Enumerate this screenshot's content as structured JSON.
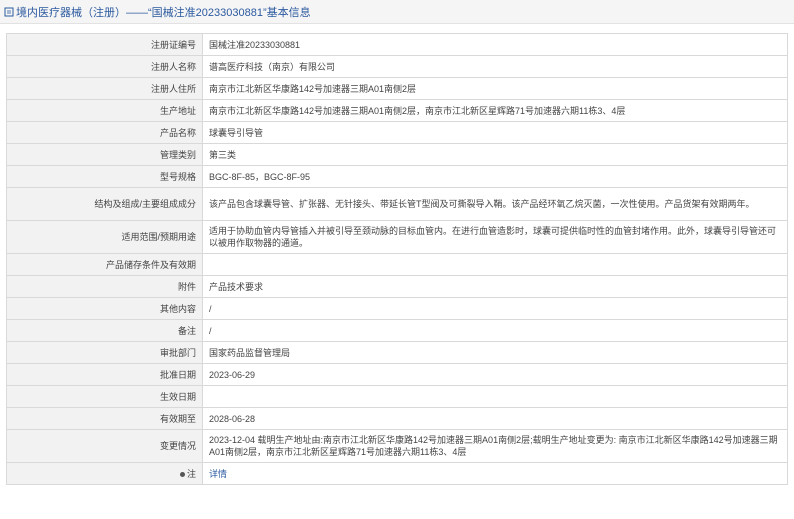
{
  "header": {
    "title": "境内医疗器械（注册）——“国械注准20233030881”基本信息"
  },
  "rows": [
    {
      "label": "注册证编号",
      "value": "国械注准20233030881"
    },
    {
      "label": "注册人名称",
      "value": "谱高医疗科技（南京）有限公司"
    },
    {
      "label": "注册人住所",
      "value": "南京市江北新区华康路142号加速器三期A01南侧2层"
    },
    {
      "label": "生产地址",
      "value": "南京市江北新区华康路142号加速器三期A01南侧2层，南京市江北新区星辉路71号加速器六期11栋3、4层"
    },
    {
      "label": "产品名称",
      "value": "球囊导引导管"
    },
    {
      "label": "管理类别",
      "value": "第三类"
    },
    {
      "label": "型号规格",
      "value": "BGC-8F-85，BGC-8F-95"
    },
    {
      "label": "结构及组成/主要组成成分",
      "value": "该产品包含球囊导管、扩张器、无针接头、带延长管T型阀及可撕裂导入鞘。该产品经环氧乙烷灭菌，一次性使用。产品货架有效期两年。"
    },
    {
      "label": "适用范围/预期用途",
      "value": "适用于协助血管内导管插入并被引导至颈动脉的目标血管内。在进行血管造影时，球囊可提供临时性的血管封堵作用。此外，球囊导引导管还可以被用作取物器的通道。"
    },
    {
      "label": "产品储存条件及有效期",
      "value": ""
    },
    {
      "label": "附件",
      "value": "产品技术要求"
    },
    {
      "label": "其他内容",
      "value": "/"
    },
    {
      "label": "备注",
      "value": "/"
    },
    {
      "label": "审批部门",
      "value": "国家药品监督管理局"
    },
    {
      "label": "批准日期",
      "value": "2023-06-29"
    },
    {
      "label": "生效日期",
      "value": ""
    },
    {
      "label": "有效期至",
      "value": "2028-06-28"
    },
    {
      "label": "变更情况",
      "value": "2023-12-04 载明生产地址由:南京市江北新区华康路142号加速器三期A01南侧2层;载明生产地址变更为: 南京市江北新区华康路142号加速器三期A01南侧2层，南京市江北新区星辉路71号加速器六期11栋3、4层"
    },
    {
      "label": "注",
      "value": "详情"
    }
  ]
}
